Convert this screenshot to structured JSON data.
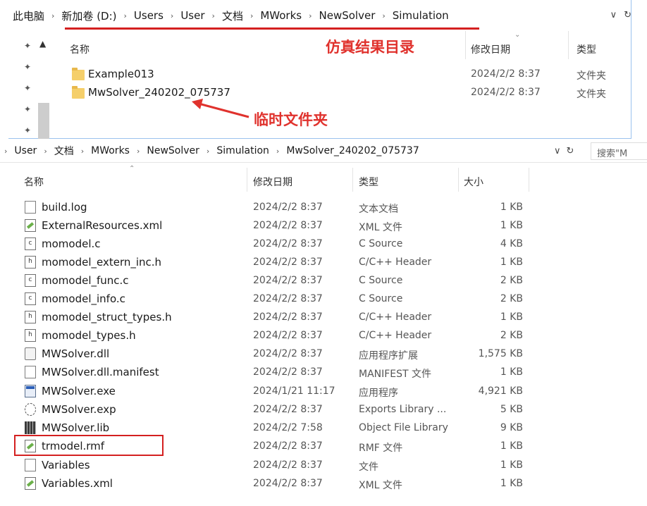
{
  "top_window": {
    "breadcrumb": [
      "此电脑",
      "新加卷 (D:)",
      "Users",
      "User",
      "文档",
      "MWorks",
      "NewSolver",
      "Simulation"
    ],
    "addr_dropdown_glyph": "∨",
    "addr_refresh_glyph": "↻",
    "headers": {
      "name": "名称",
      "date": "修改日期",
      "type": "类型"
    },
    "annotation_title": "仿真结果目录",
    "annotation_temp": "临时文件夹",
    "items": [
      {
        "name": "Example013",
        "date": "2024/2/2 8:37",
        "type": "文件夹"
      },
      {
        "name": "MwSolver_240202_075737",
        "date": "2024/2/2 8:37",
        "type": "文件夹"
      }
    ]
  },
  "bottom_window": {
    "breadcrumb": [
      "User",
      "文档",
      "MWorks",
      "NewSolver",
      "Simulation",
      "MwSolver_240202_075737"
    ],
    "search_placeholder": "搜索\"M",
    "addr_dropdown_glyph": "∨",
    "addr_refresh_glyph": "↻",
    "headers": {
      "name": "名称",
      "date": "修改日期",
      "type": "类型",
      "size": "大小"
    },
    "files": [
      {
        "icon": "text-file-icon",
        "name": "build.log",
        "date": "2024/2/2 8:37",
        "type": "文本文档",
        "size": "1 KB"
      },
      {
        "icon": "xml-file-icon",
        "name": "ExternalResources.xml",
        "date": "2024/2/2 8:37",
        "type": "XML 文件",
        "size": "1 KB"
      },
      {
        "icon": "c-source-icon",
        "name": "momodel.c",
        "date": "2024/2/2 8:37",
        "type": "C Source",
        "size": "4 KB"
      },
      {
        "icon": "header-file-icon",
        "name": "momodel_extern_inc.h",
        "date": "2024/2/2 8:37",
        "type": "C/C++ Header",
        "size": "1 KB"
      },
      {
        "icon": "c-source-icon",
        "name": "momodel_func.c",
        "date": "2024/2/2 8:37",
        "type": "C Source",
        "size": "2 KB"
      },
      {
        "icon": "c-source-icon",
        "name": "momodel_info.c",
        "date": "2024/2/2 8:37",
        "type": "C Source",
        "size": "2 KB"
      },
      {
        "icon": "header-file-icon",
        "name": "momodel_struct_types.h",
        "date": "2024/2/2 8:37",
        "type": "C/C++ Header",
        "size": "1 KB"
      },
      {
        "icon": "header-file-icon",
        "name": "momodel_types.h",
        "date": "2024/2/2 8:37",
        "type": "C/C++ Header",
        "size": "2 KB"
      },
      {
        "icon": "dll-file-icon",
        "name": "MWSolver.dll",
        "date": "2024/2/2 8:37",
        "type": "应用程序扩展",
        "size": "1,575 KB"
      },
      {
        "icon": "text-file-icon",
        "name": "MWSolver.dll.manifest",
        "date": "2024/2/2 8:37",
        "type": "MANIFEST 文件",
        "size": "1 KB"
      },
      {
        "icon": "exe-file-icon",
        "name": "MWSolver.exe",
        "date": "2024/1/21 11:17",
        "type": "应用程序",
        "size": "4,921 KB"
      },
      {
        "icon": "exp-file-icon",
        "name": "MWSolver.exp",
        "date": "2024/2/2 8:37",
        "type": "Exports Library ...",
        "size": "5 KB"
      },
      {
        "icon": "lib-file-icon",
        "name": "MWSolver.lib",
        "date": "2024/2/2 7:58",
        "type": "Object File Library",
        "size": "9 KB"
      },
      {
        "icon": "xml-file-icon",
        "name": "trmodel.rmf",
        "date": "2024/2/2 8:37",
        "type": "RMF 文件",
        "size": "1 KB"
      },
      {
        "icon": "text-file-icon",
        "name": "Variables",
        "date": "2024/2/2 8:37",
        "type": "文件",
        "size": "1 KB"
      },
      {
        "icon": "xml-file-icon",
        "name": "Variables.xml",
        "date": "2024/2/2 8:37",
        "type": "XML 文件",
        "size": "1 KB"
      }
    ]
  },
  "colors": {
    "annotation_red": "#e0322d",
    "folder_yellow": "#f5cf6a",
    "highlight_red": "#d42020"
  }
}
